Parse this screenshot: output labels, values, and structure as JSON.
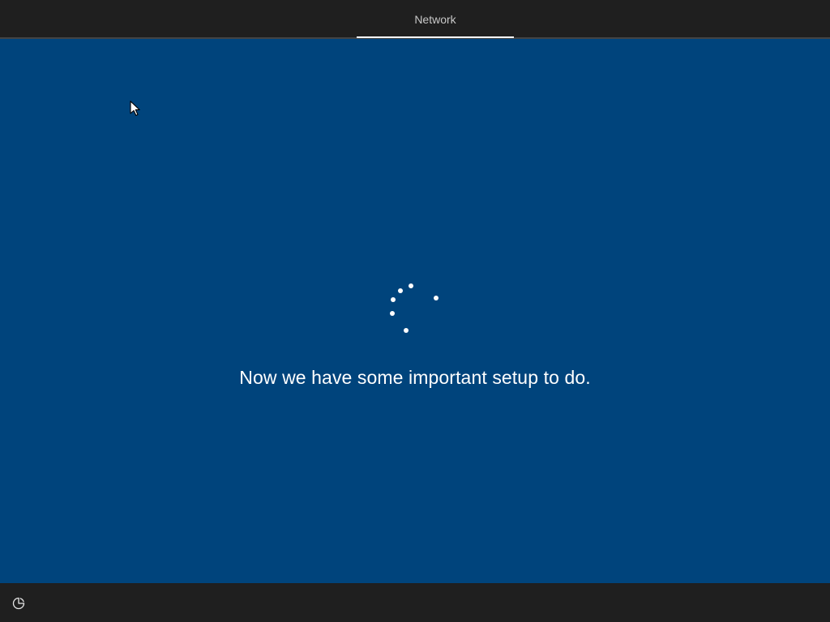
{
  "header": {
    "tabs": [
      {
        "label": "Network",
        "active": true
      }
    ]
  },
  "main": {
    "status_message": "Now we have some important setup to do.",
    "spinner_icon": "loading-spinner-icon",
    "background_color": "#00447c"
  },
  "footer": {
    "accessibility_icon": "ease-of-access-icon"
  },
  "colors": {
    "bar_background": "#1f1f1f",
    "main_background": "#00447c",
    "text": "#ffffff",
    "tab_text": "#c8c8c8"
  }
}
